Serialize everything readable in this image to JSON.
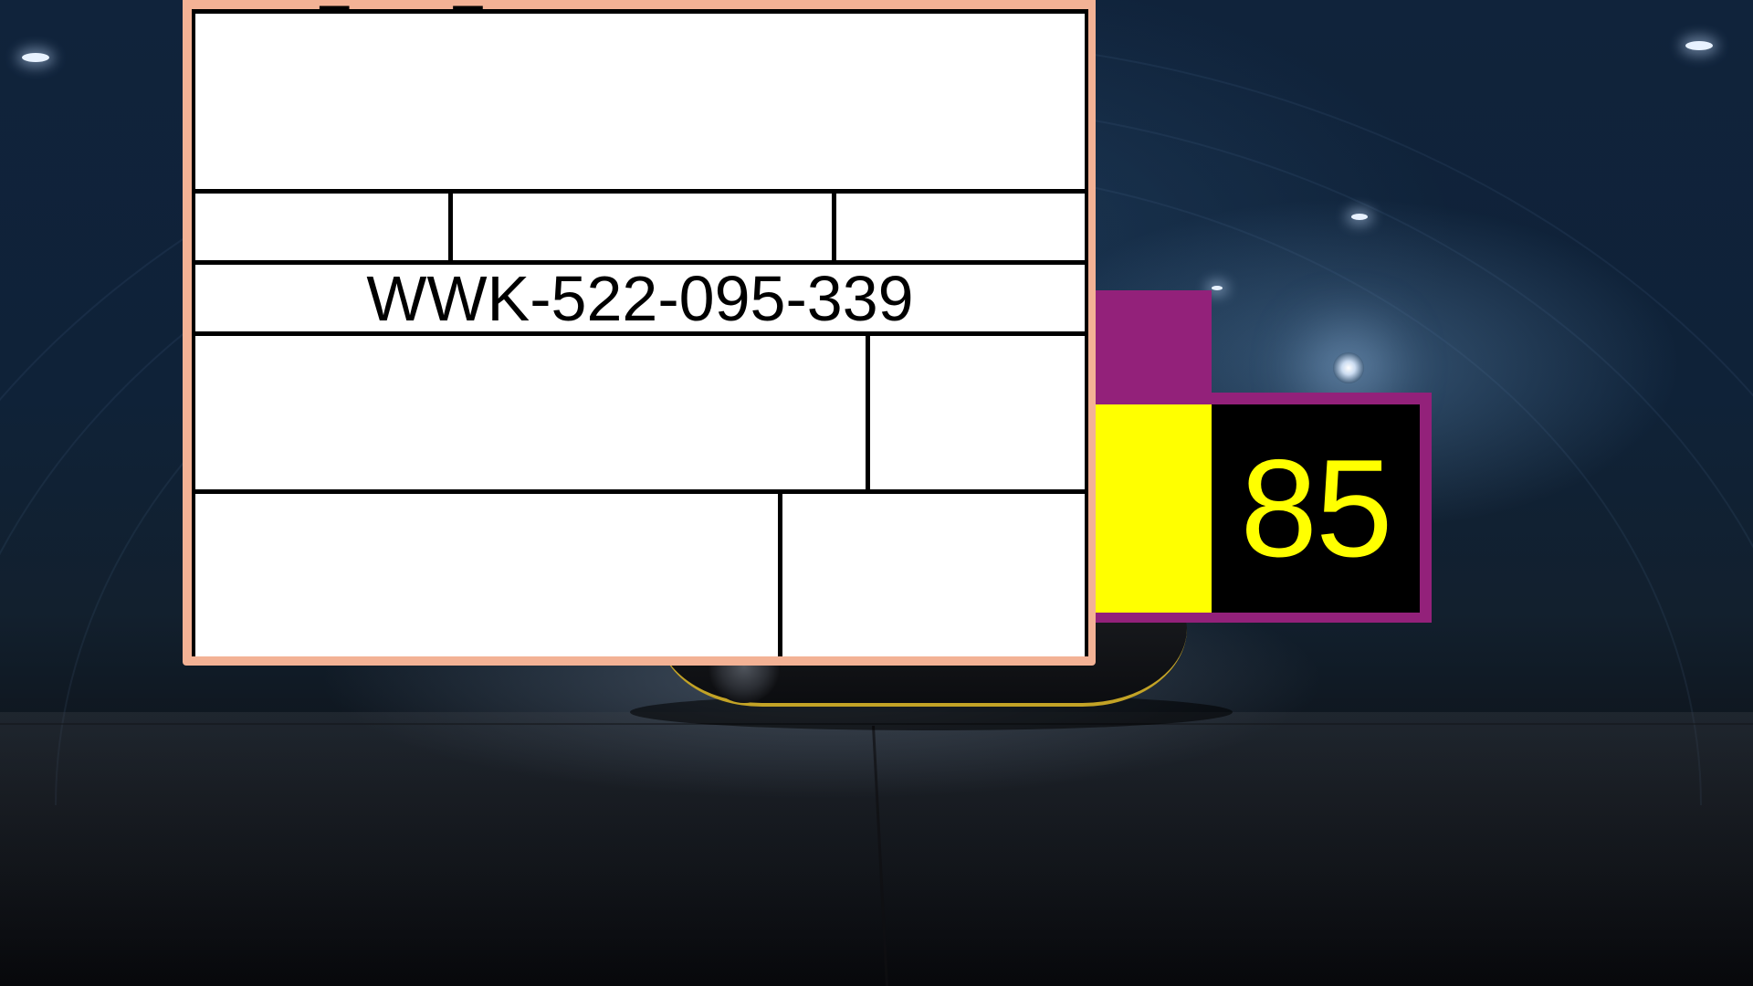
{
  "label_window": {
    "title": "white_VDA_label",
    "serial_number": "WWK-522-095-339",
    "frame_color": "#f3b295",
    "sheet_color": "#ffffff",
    "line_color": "#000000"
  },
  "score_badge": {
    "value": "85",
    "frame_color": "#93217a",
    "swatch_color": "#ffff00",
    "panel_color": "#000000",
    "text_color": "#ffff00"
  },
  "background": {
    "scene": "dark tunnel with car",
    "icons": [
      "ceiling-light-icon",
      "spot-light-icon"
    ]
  }
}
